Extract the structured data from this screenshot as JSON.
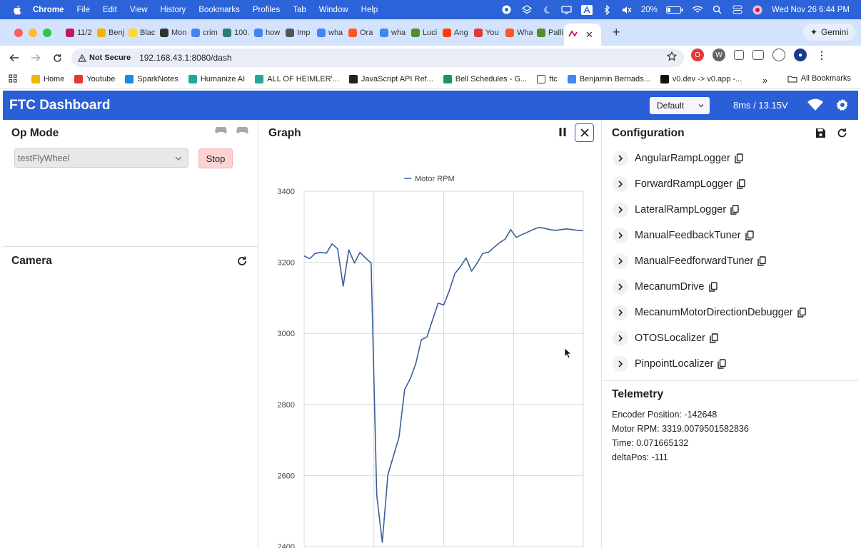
{
  "mac_menu": {
    "app": "Chrome",
    "items": [
      "File",
      "Edit",
      "View",
      "History",
      "Bookmarks",
      "Profiles",
      "Tab",
      "Window",
      "Help"
    ],
    "battery": "20%",
    "datetime": "Wed Nov 26  6:44 PM"
  },
  "tabs": [
    {
      "label": "11/2",
      "color": "#c2185b"
    },
    {
      "label": "Benj",
      "color": "#f4b400"
    },
    {
      "label": "Blac",
      "color": "#fdd835"
    },
    {
      "label": "Mon",
      "color": "#333333"
    },
    {
      "label": "crim",
      "color": "#4285f4"
    },
    {
      "label": "100.",
      "color": "#2e7d6f"
    },
    {
      "label": "how",
      "color": "#4285f4"
    },
    {
      "label": "Imp",
      "color": "#555555"
    },
    {
      "label": "wha",
      "color": "#4285f4"
    },
    {
      "label": "Ora",
      "color": "#ff5722"
    },
    {
      "label": "wha",
      "color": "#4285f4"
    },
    {
      "label": "Luci",
      "color": "#558b2f"
    },
    {
      "label": "Ang",
      "color": "#ff3d00"
    },
    {
      "label": "You",
      "color": "#e53935"
    },
    {
      "label": "Wha",
      "color": "#ff5722"
    },
    {
      "label": "Palli",
      "color": "#558b2f"
    }
  ],
  "gemini_label": "Gemini",
  "address": {
    "security": "Not Secure",
    "url": "192.168.43.1:8080/dash"
  },
  "bookmarks": [
    {
      "label": "Home",
      "color": "#f4b400"
    },
    {
      "label": "Youtube",
      "color": "#e53935"
    },
    {
      "label": "SparkNotes",
      "color": "#1e88e5"
    },
    {
      "label": "Humanize AI",
      "color": "#26a69a"
    },
    {
      "label": "ALL OF HEIMLER'...",
      "color": "#26a69a"
    },
    {
      "label": "JavaScript API Ref...",
      "color": "#222222"
    },
    {
      "label": "Bell Schedules - G...",
      "color": "#0f9d58"
    },
    {
      "label": "ftc",
      "color": "#ffffff"
    },
    {
      "label": "Benjamin Bernads...",
      "color": "#4285f4"
    },
    {
      "label": "v0.dev -> v0.app -...",
      "color": "#111111"
    }
  ],
  "all_bookmarks": "All Bookmarks",
  "dashboard": {
    "title": "FTC Dashboard",
    "layout": "Default",
    "latency": "8ms / 13.15V",
    "accent": "#2a5fd8"
  },
  "opmode": {
    "title": "Op Mode",
    "selected": "testFlyWheel",
    "stop_label": "Stop"
  },
  "camera": {
    "title": "Camera"
  },
  "graph": {
    "title": "Graph"
  },
  "chart_data": {
    "type": "line",
    "series": [
      {
        "name": "Motor RPM",
        "color": "#3a5f9a",
        "x": [
          0,
          2,
          4,
          6,
          8,
          10,
          12,
          14,
          16,
          18,
          20,
          22,
          24,
          26,
          28,
          30,
          32,
          34,
          36,
          38,
          40,
          42,
          44,
          46,
          48,
          50,
          52,
          54,
          56,
          58,
          60,
          62,
          64,
          66,
          68,
          70,
          72,
          74,
          76,
          78,
          80,
          82,
          84,
          86,
          88,
          90,
          92,
          94,
          96,
          98,
          100
        ],
        "y": [
          3218,
          3210,
          3225,
          3228,
          3226,
          3252,
          3238,
          3133,
          3235,
          3198,
          3228,
          3212,
          3198,
          2545,
          2412,
          2602,
          2655,
          2708,
          2842,
          2872,
          2915,
          2982,
          2990,
          3038,
          3085,
          3080,
          3120,
          3168,
          3188,
          3212,
          3175,
          3198,
          3225,
          3228,
          3242,
          3255,
          3265,
          3292,
          3270,
          3278,
          3285,
          3292,
          3298,
          3296,
          3292,
          3290,
          3292,
          3294,
          3292,
          3290,
          3289
        ]
      }
    ],
    "yticks": [
      2400,
      2600,
      2800,
      3000,
      3200,
      3400
    ],
    "ylim": [
      2400,
      3400
    ],
    "grid": true,
    "legend": "top-center"
  },
  "config": {
    "title": "Configuration",
    "items": [
      "AngularRampLogger",
      "ForwardRampLogger",
      "LateralRampLogger",
      "ManualFeedbackTuner",
      "ManualFeedforwardTuner",
      "MecanumDrive",
      "MecanumMotorDirectionDebugger",
      "OTOSLocalizer",
      "PinpointLocalizer"
    ]
  },
  "telemetry": {
    "title": "Telemetry",
    "lines": [
      "Encoder Position: -142648",
      "Motor RPM: 3319.0079501582836",
      "Time: 0.071665132",
      "deltaPos: -111"
    ]
  }
}
